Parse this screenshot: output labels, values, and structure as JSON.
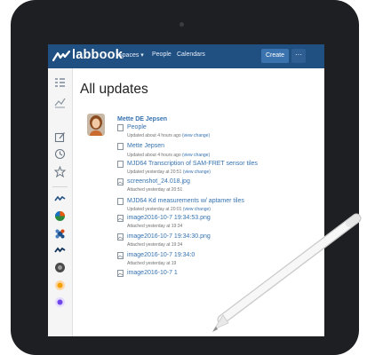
{
  "app": {
    "name": "labbook",
    "accent": "#205081",
    "link_color": "#3572b0",
    "sidebar_icons": [
      "menu-icon",
      "activity-icon",
      "edit-icon",
      "clock-icon",
      "star-icon",
      "labbook-space-icon",
      "colorful-space-icon",
      "blue-flower-space-icon",
      "dark-space-icon",
      "gear-space-icon",
      "orange-space-icon",
      "purple-space-icon"
    ]
  },
  "nav": {
    "spaces": "Spaces ▾",
    "people": "People",
    "calendars": "Calendars",
    "create": "Create",
    "more": "···"
  },
  "page": {
    "title": "All updates"
  },
  "author": {
    "name": "Mette DE Jepsen"
  },
  "feed": [
    {
      "title": "People",
      "meta_text": "Updated about 4 hours ago",
      "meta_link": "(view change)"
    },
    {
      "title": "Mette Jepsen",
      "meta_text": "Updated about 4 hours ago",
      "meta_link": "(view change)"
    },
    {
      "title": "MJD64 Transcription of SAM-FRET sensor tiles",
      "meta_text": "Updated yesterday at 20:51",
      "meta_link": "(view change)"
    },
    {
      "title": "screenshot_24.018.jpg",
      "meta_text": "Attached yesterday at 20:51",
      "meta_link": ""
    },
    {
      "title": "MJD64 Kd measurements w/ aptamer tiles",
      "meta_text": "Updated yesterday at 20:01",
      "meta_link": "(view change)"
    },
    {
      "title": "image2016-10-7 19:34:53.png",
      "meta_text": "Attached yesterday at 19:34",
      "meta_link": ""
    },
    {
      "title": "image2016-10-7 19:34:30.png",
      "meta_text": "Attached yesterday at 19:34",
      "meta_link": ""
    },
    {
      "title": "image2016-10-7 19:34:0",
      "meta_text": "Attached yesterday at 19",
      "meta_link": ""
    },
    {
      "title": "image2016-10-7 1",
      "meta_text": "",
      "meta_link": ""
    }
  ]
}
